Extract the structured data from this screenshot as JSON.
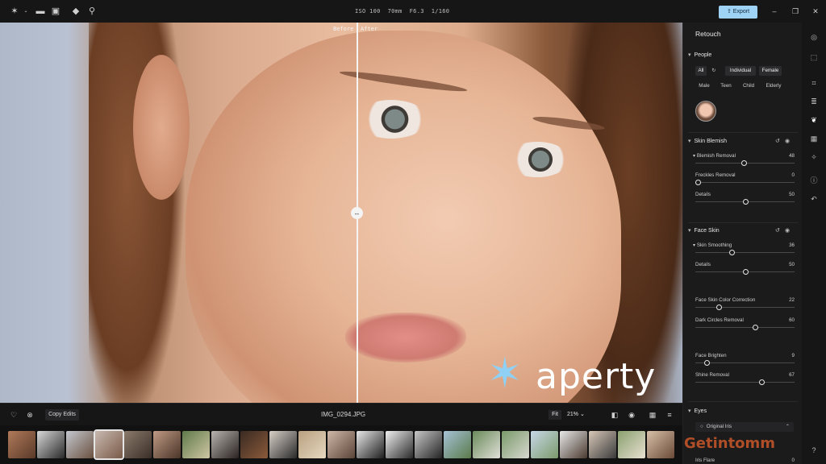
{
  "toolbar": {
    "icons": [
      "aperty-logo-icon",
      "folder-icon",
      "gallery-icon",
      "eraser-icon",
      "magnifier-icon"
    ],
    "camera": {
      "iso": "ISO 100",
      "focal": "70mm",
      "aperture": "F6.3",
      "shutter": "1/160"
    },
    "export_label": "Export"
  },
  "canvas": {
    "before_label": "Before",
    "after_label": "After",
    "logo_text": "aperty"
  },
  "bottombar": {
    "copy_label": "Copy Edits",
    "filename": "IMG_0294.JPG",
    "fit_label": "Fit",
    "zoom_label": "21% ⌄"
  },
  "panel": {
    "title": "Retouch",
    "people": {
      "title": "People",
      "row1": [
        "All",
        "↻",
        "Individual",
        "Female"
      ],
      "row2": [
        "Male",
        "Teen",
        "Child",
        "Elderly"
      ]
    },
    "skin_blemish": {
      "title": "Skin Blemish",
      "sliders": [
        {
          "label": "Blemish Removal",
          "value": 48,
          "caret": true
        },
        {
          "label": "Freckles Removal",
          "value": 0
        },
        {
          "label": "Details",
          "value": 50
        }
      ]
    },
    "face_skin": {
      "title": "Face Skin",
      "sliders": [
        {
          "label": "Skin Smoothing",
          "value": 36,
          "caret": true
        },
        {
          "label": "Details",
          "value": 50
        },
        {
          "label": "Face Skin Color Correction",
          "value": 22
        },
        {
          "label": "Dark Circles Removal",
          "value": 60
        },
        {
          "label": "Face Brighten",
          "value": 9
        },
        {
          "label": "Shine Removal",
          "value": 67
        }
      ]
    },
    "eyes": {
      "title": "Eyes",
      "dropdown": "Original Iris",
      "slider_label": "Iris Flare",
      "slider_value": 0
    }
  },
  "watermark": "Getintomm",
  "colors": {
    "accent": "#9fd3f5",
    "panel": "#1b1b1c",
    "bar": "#161617"
  }
}
